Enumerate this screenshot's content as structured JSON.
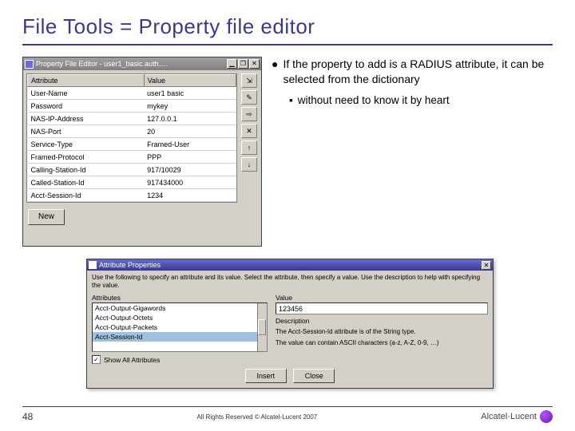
{
  "title": "File Tools = Property file editor",
  "bullets": {
    "b1": "If the property to add is a RADIUS attribute, it can be selected  from the dictionary",
    "b2": "without need to know it by heart"
  },
  "pfe": {
    "window_title": "Property File Editor - user1_basic.auth….",
    "columns": {
      "attr": "Attribute",
      "val": "Value"
    },
    "rows": [
      {
        "attr": "User-Name",
        "val": "user1 basic"
      },
      {
        "attr": "Password",
        "val": "mykey"
      },
      {
        "attr": "NAS-IP-Address",
        "val": "127.0.0.1"
      },
      {
        "attr": "NAS-Port",
        "val": "20"
      },
      {
        "attr": "Service-Type",
        "val": "Framed-User"
      },
      {
        "attr": "Framed-Protocol",
        "val": "PPP"
      },
      {
        "attr": "Calling-Station-Id",
        "val": "917/10029"
      },
      {
        "attr": "Called-Station-Id",
        "val": "917434000"
      },
      {
        "attr": "Acct-Session-Id",
        "val": "1234"
      }
    ],
    "side_icons": [
      "⇲",
      "✎",
      "⇨",
      "✕",
      "↑",
      "↓"
    ],
    "new_btn": "New"
  },
  "attr_dialog": {
    "title": "Attribute Properties",
    "instruction": "Use the following to specify an attribute and its value. Select the attribute, then specify a value. Use the description to help with specifying the value.",
    "labels": {
      "attributes": "Attributes",
      "value": "Value",
      "description": "Description"
    },
    "list": [
      "Acct-Output-Gigawords",
      "Acct-Output-Octets",
      "Acct-Output-Packets",
      "Acct-Session-Id"
    ],
    "selected_index": 3,
    "value_input": "123456",
    "desc1": "The Acct-Session-Id attribute is of the String type.",
    "desc2": "The value can contain ASCII characters (a-z, A-Z, 0-9, …)",
    "show_all": "Show All Attributes",
    "show_all_checked": "✓",
    "insert_btn": "Insert",
    "close_btn": "Close"
  },
  "footer": {
    "page": "48",
    "copyright": "All Rights Reserved © Alcatel-Lucent 2007",
    "logo_text": "Alcatel·Lucent"
  }
}
